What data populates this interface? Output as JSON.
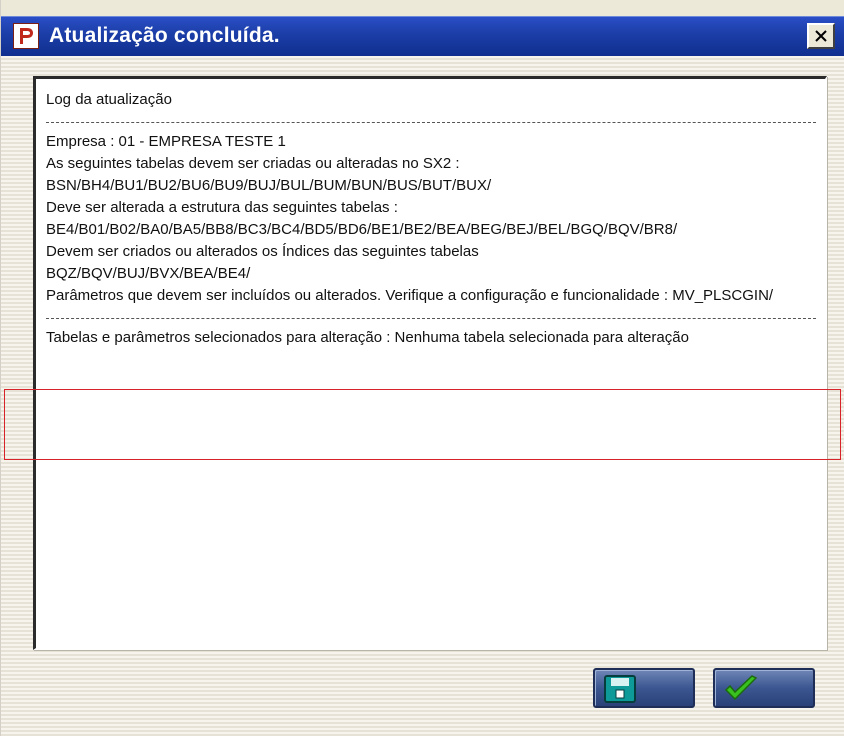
{
  "window": {
    "title": "Atualização concluída."
  },
  "log": {
    "heading": "Log da atualização",
    "lines": [
      "Empresa : 01 - EMPRESA TESTE 1",
      "As seguintes tabelas devem ser criadas ou alteradas no SX2 :",
      "BSN/BH4/BU1/BU2/BU6/BU9/BUJ/BUL/BUM/BUN/BUS/BUT/BUX/",
      "Deve ser alterada a estrutura das seguintes tabelas :",
      "BE4/B01/B02/BA0/BA5/BB8/BC3/BC4/BD5/BD6/BE1/BE2/BEA/BEG/BEJ/BEL/BGQ/BQV/BR8/",
      "Devem ser criados ou alterados os Índices das seguintes tabelas",
      "BQZ/BQV/BUJ/BVX/BEA/BE4/",
      "Parâmetros que devem ser incluídos ou alterados. Verifique a configuração e funcionalidade : MV_PLSCGIN/"
    ],
    "summary": "Tabelas e parâmetros selecionados para alteração : Nenhuma tabela selecionada para alteração"
  },
  "buttons": {
    "save_icon": "save-disk-icon",
    "ok_icon": "checkmark-icon"
  },
  "colors": {
    "titlebar": "#1b3da6",
    "highlight": "#d8222a",
    "window_bg": "#ece9d8"
  }
}
